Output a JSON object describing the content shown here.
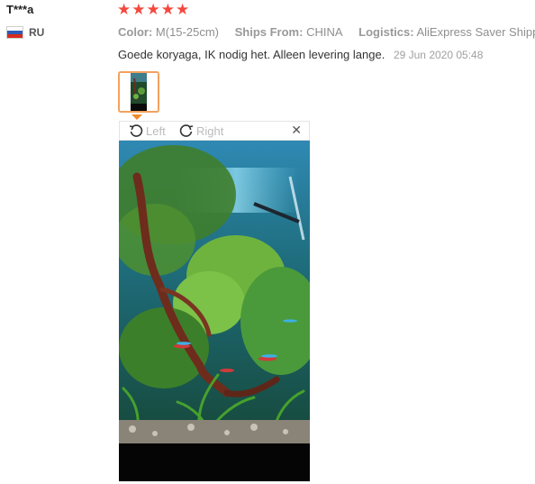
{
  "reviewer": {
    "name": "T***a",
    "country_code": "RU",
    "flag_icon": "russia-flag-icon"
  },
  "rating": {
    "stars": 5,
    "max": 5,
    "star_glyph": "★",
    "star_color": "#f5483d"
  },
  "attributes": [
    {
      "key": "Color:",
      "value": "M(15-25cm)"
    },
    {
      "key": "Ships From:",
      "value": "CHINA"
    },
    {
      "key": "Logistics:",
      "value": "AliExpress Saver Shipping"
    }
  ],
  "feedback": {
    "text": "Goede koryaga, IK nodig het. Alleen levering lange.",
    "date": "29 Jun 2020 05:48"
  },
  "viewer": {
    "rotate_left_label": "Left",
    "rotate_right_label": "Right",
    "close_glyph": "✕",
    "thumb_border_color": "#f4a15d",
    "image_description_icon": "aquarium-photo"
  }
}
